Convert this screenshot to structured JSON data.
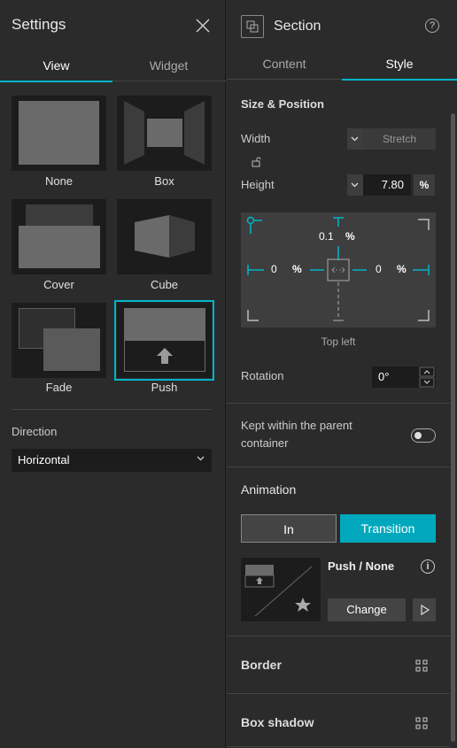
{
  "left_panel": {
    "title": "Settings",
    "tabs": [
      {
        "label": "View",
        "active": true
      },
      {
        "label": "Widget",
        "active": false
      }
    ],
    "transitions": [
      {
        "label": "None"
      },
      {
        "label": "Box"
      },
      {
        "label": "Cover"
      },
      {
        "label": "Cube"
      },
      {
        "label": "Fade"
      },
      {
        "label": "Push",
        "selected": true
      }
    ],
    "direction": {
      "label": "Direction",
      "value": "Horizontal"
    }
  },
  "right_panel": {
    "title": "Section",
    "help": "?",
    "tabs": [
      {
        "label": "Content",
        "active": false
      },
      {
        "label": "Style",
        "active": true
      }
    ],
    "size_position": {
      "title": "Size & Position",
      "width_label": "Width",
      "width_mode": "Stretch",
      "height_label": "Height",
      "height_value": "7.80",
      "height_unit": "%",
      "top_value": "0.1",
      "top_unit": "%",
      "left_value": "0",
      "left_unit": "%",
      "right_value": "0",
      "right_unit": "%",
      "anchor_caption": "Top left",
      "rotation_label": "Rotation",
      "rotation_value": "0°"
    },
    "kept_within": {
      "label_line1": "Kept within the parent",
      "label_line2": "container",
      "enabled": false
    },
    "animation": {
      "title": "Animation",
      "in_label": "In",
      "transition_label": "Transition",
      "name": "Push / None",
      "info": "i",
      "change_label": "Change"
    },
    "border": {
      "title": "Border"
    },
    "box_shadow": {
      "title": "Box shadow"
    }
  },
  "colors": {
    "accent": "#00b4c9",
    "panel_bg": "#2b2b2b",
    "input_bg": "#1c1c1c"
  }
}
